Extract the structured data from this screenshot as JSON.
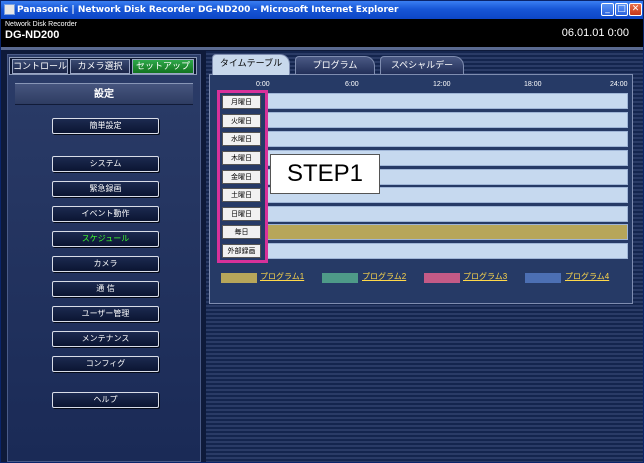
{
  "window": {
    "title": "Panasonic | Network Disk Recorder DG-ND200 - Microsoft Internet Explorer",
    "min": "_",
    "max": "□",
    "close": "✕"
  },
  "header": {
    "product_small": "Network Disk Recorder",
    "product_model": "DG-ND200",
    "datetime": "06.01.01  0:00"
  },
  "modes": {
    "control": "コントロール",
    "camera_select": "カメラ選択",
    "setup": "セットアップ"
  },
  "left": {
    "title": "設定",
    "menu": {
      "easy_setup": "簡単設定",
      "system": "システム",
      "emergency": "緊急録画",
      "event": "イベント動作",
      "schedule": "スケジュール",
      "camera": "カメラ",
      "comm": "通 信",
      "user": "ユーザー管理",
      "maintenance": "メンテナンス",
      "config": "コンフィグ",
      "help": "ヘルプ"
    }
  },
  "tabs": {
    "timetable": "タイムテーブル",
    "program": "プログラム",
    "special_day": "スペシャルデー"
  },
  "timetable": {
    "ticks": [
      "0:00",
      "6:00",
      "12:00",
      "18:00",
      "24:00"
    ],
    "days": [
      "月曜日",
      "火曜日",
      "水曜日",
      "木曜日",
      "金曜日",
      "土曜日",
      "日曜日",
      "毎日",
      "外部録画"
    ]
  },
  "step_label": "STEP1",
  "legend": [
    {
      "label": "プログラム1",
      "color": "#b7a65a"
    },
    {
      "label": "プログラム2",
      "color": "#4e9a88"
    },
    {
      "label": "プログラム3",
      "color": "#c45a86"
    },
    {
      "label": "プログラム4",
      "color": "#4c6fb3"
    }
  ],
  "colors": {
    "accent_active": "#40ff30",
    "step_highlight": "#d8319a",
    "everyday_row": "#b7a65a"
  }
}
